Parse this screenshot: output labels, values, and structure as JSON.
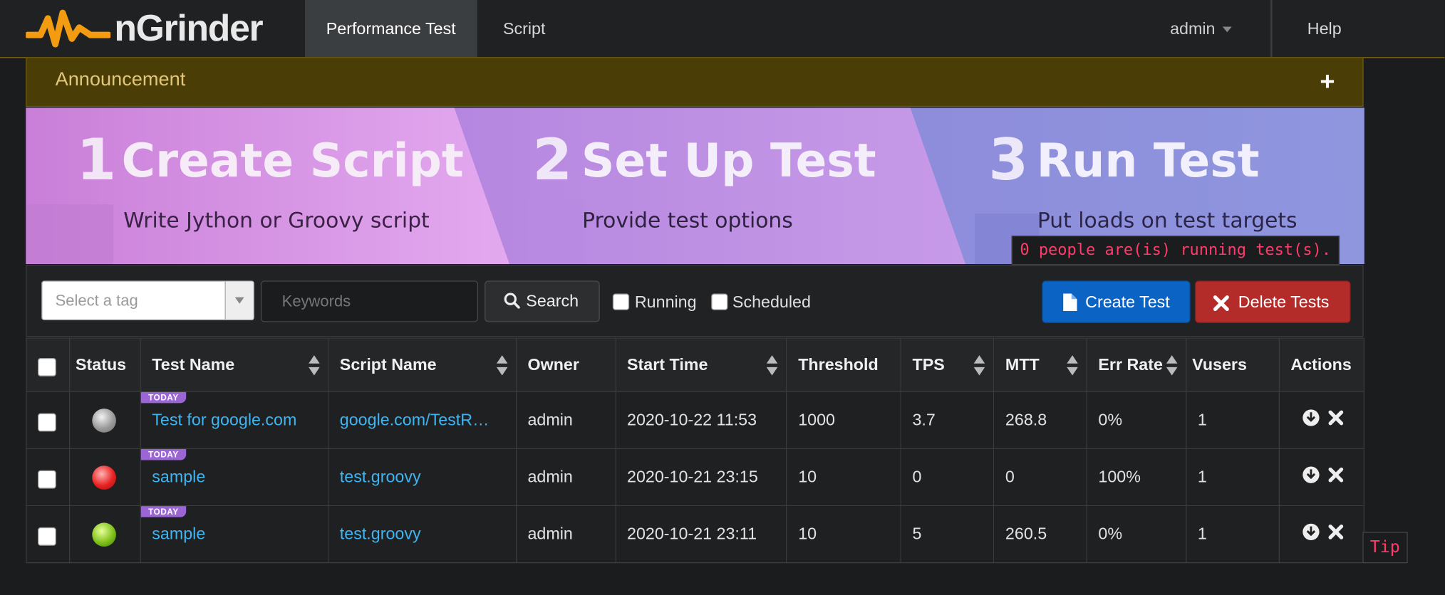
{
  "navbar": {
    "brand": "nGrinder",
    "tabs": [
      "Performance Test",
      "Script"
    ],
    "user": "admin",
    "help": "Help"
  },
  "announcement": {
    "title": "Announcement",
    "toggle": "+"
  },
  "banner": {
    "steps": [
      {
        "num": "1",
        "title": "Create Script",
        "subtitle": "Write Jython or Groovy script"
      },
      {
        "num": "2",
        "title": "Set Up Test",
        "subtitle": "Provide test options"
      },
      {
        "num": "3",
        "title": "Run Test",
        "subtitle": "Put loads on test targets"
      }
    ],
    "running_text": "0 people are(is) running test(s)."
  },
  "filters": {
    "tag_placeholder": "Select a tag",
    "keyword_placeholder": "Keywords",
    "search_label": "Search",
    "running_label": "Running",
    "scheduled_label": "Scheduled",
    "create_label": "Create Test",
    "delete_label": "Delete Tests"
  },
  "table": {
    "headers": [
      "Status",
      "Test Name",
      "Script Name",
      "Owner",
      "Start Time",
      "Threshold",
      "TPS",
      "MTT",
      "Err Rate",
      "Vusers",
      "Actions"
    ],
    "today_badge": "TODAY",
    "rows": [
      {
        "status": "gray",
        "test_name": "Test for google.com",
        "script_name": "google.com/TestR…",
        "owner": "admin",
        "start_time": "2020-10-22 11:53",
        "threshold": "1000",
        "tps": "3.7",
        "mtt": "268.8",
        "err_rate": "0%",
        "vusers": "1"
      },
      {
        "status": "red",
        "test_name": "sample",
        "script_name": "test.groovy",
        "owner": "admin",
        "start_time": "2020-10-21 23:15",
        "threshold": "10",
        "tps": "0",
        "mtt": "0",
        "err_rate": "100%",
        "vusers": "1"
      },
      {
        "status": "green",
        "test_name": "sample",
        "script_name": "test.groovy",
        "owner": "admin",
        "start_time": "2020-10-21 23:11",
        "threshold": "10",
        "tps": "5",
        "mtt": "260.5",
        "err_rate": "0%",
        "vusers": "1"
      }
    ]
  },
  "tip": "Tip",
  "colors": {
    "accent_orange": "#f39c12",
    "link_blue": "#3fb4f0",
    "create_blue": "#0b63c4",
    "delete_red": "#b32c2a",
    "today_purple": "#9b65d6"
  }
}
